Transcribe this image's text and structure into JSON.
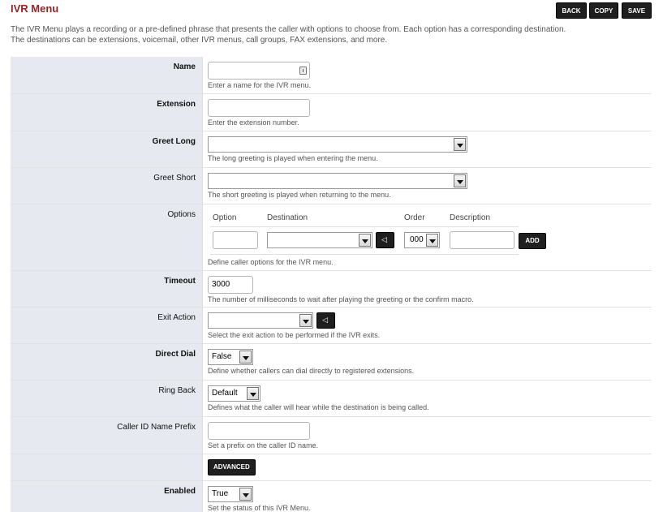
{
  "page": {
    "title": "IVR Menu",
    "description": "The IVR Menu plays a recording or a pre-defined phrase that presents the caller with options to choose from. Each option has a corresponding destination. The destinations can be extensions, voicemail, other IVR menus, call groups, FAX extensions, and more."
  },
  "toolbar": {
    "back": "BACK",
    "copy": "COPY",
    "save": "SAVE"
  },
  "fields": {
    "name": {
      "label": "Name",
      "value": "",
      "hint": "Enter a name for the IVR menu."
    },
    "extension": {
      "label": "Extension",
      "value": "",
      "hint": "Enter the extension number."
    },
    "greet_long": {
      "label": "Greet Long",
      "value": "",
      "hint": "The long greeting is played when entering the menu."
    },
    "greet_short": {
      "label": "Greet Short",
      "value": "",
      "hint": "The short greeting is played when returning to the menu."
    },
    "options": {
      "label": "Options",
      "col_option": "Option",
      "col_destination": "Destination",
      "col_order": "Order",
      "col_description": "Description",
      "order_value": "000",
      "add": "ADD",
      "hint": "Define caller options for the IVR menu."
    },
    "timeout": {
      "label": "Timeout",
      "value": "3000",
      "hint": "The number of milliseconds to wait after playing the greeting or the confirm macro."
    },
    "exit_action": {
      "label": "Exit Action",
      "value": "",
      "hint": "Select the exit action to be performed if the IVR exits."
    },
    "direct_dial": {
      "label": "Direct Dial",
      "value": "False",
      "hint": "Define whether callers can dial directly to registered extensions."
    },
    "ring_back": {
      "label": "Ring Back",
      "value": "Default",
      "hint": "Defines what the caller will hear while the destination is being called."
    },
    "cid_prefix": {
      "label": "Caller ID Name Prefix",
      "value": "",
      "hint": "Set a prefix on the caller ID name."
    },
    "advanced": {
      "label": "ADVANCED"
    },
    "enabled": {
      "label": "Enabled",
      "value": "True",
      "hint": "Set the status of this IVR Menu."
    }
  },
  "colors": {
    "title": "#952424",
    "label_bg": "#e6e9ef",
    "button_bg": "#1f1f1f"
  }
}
